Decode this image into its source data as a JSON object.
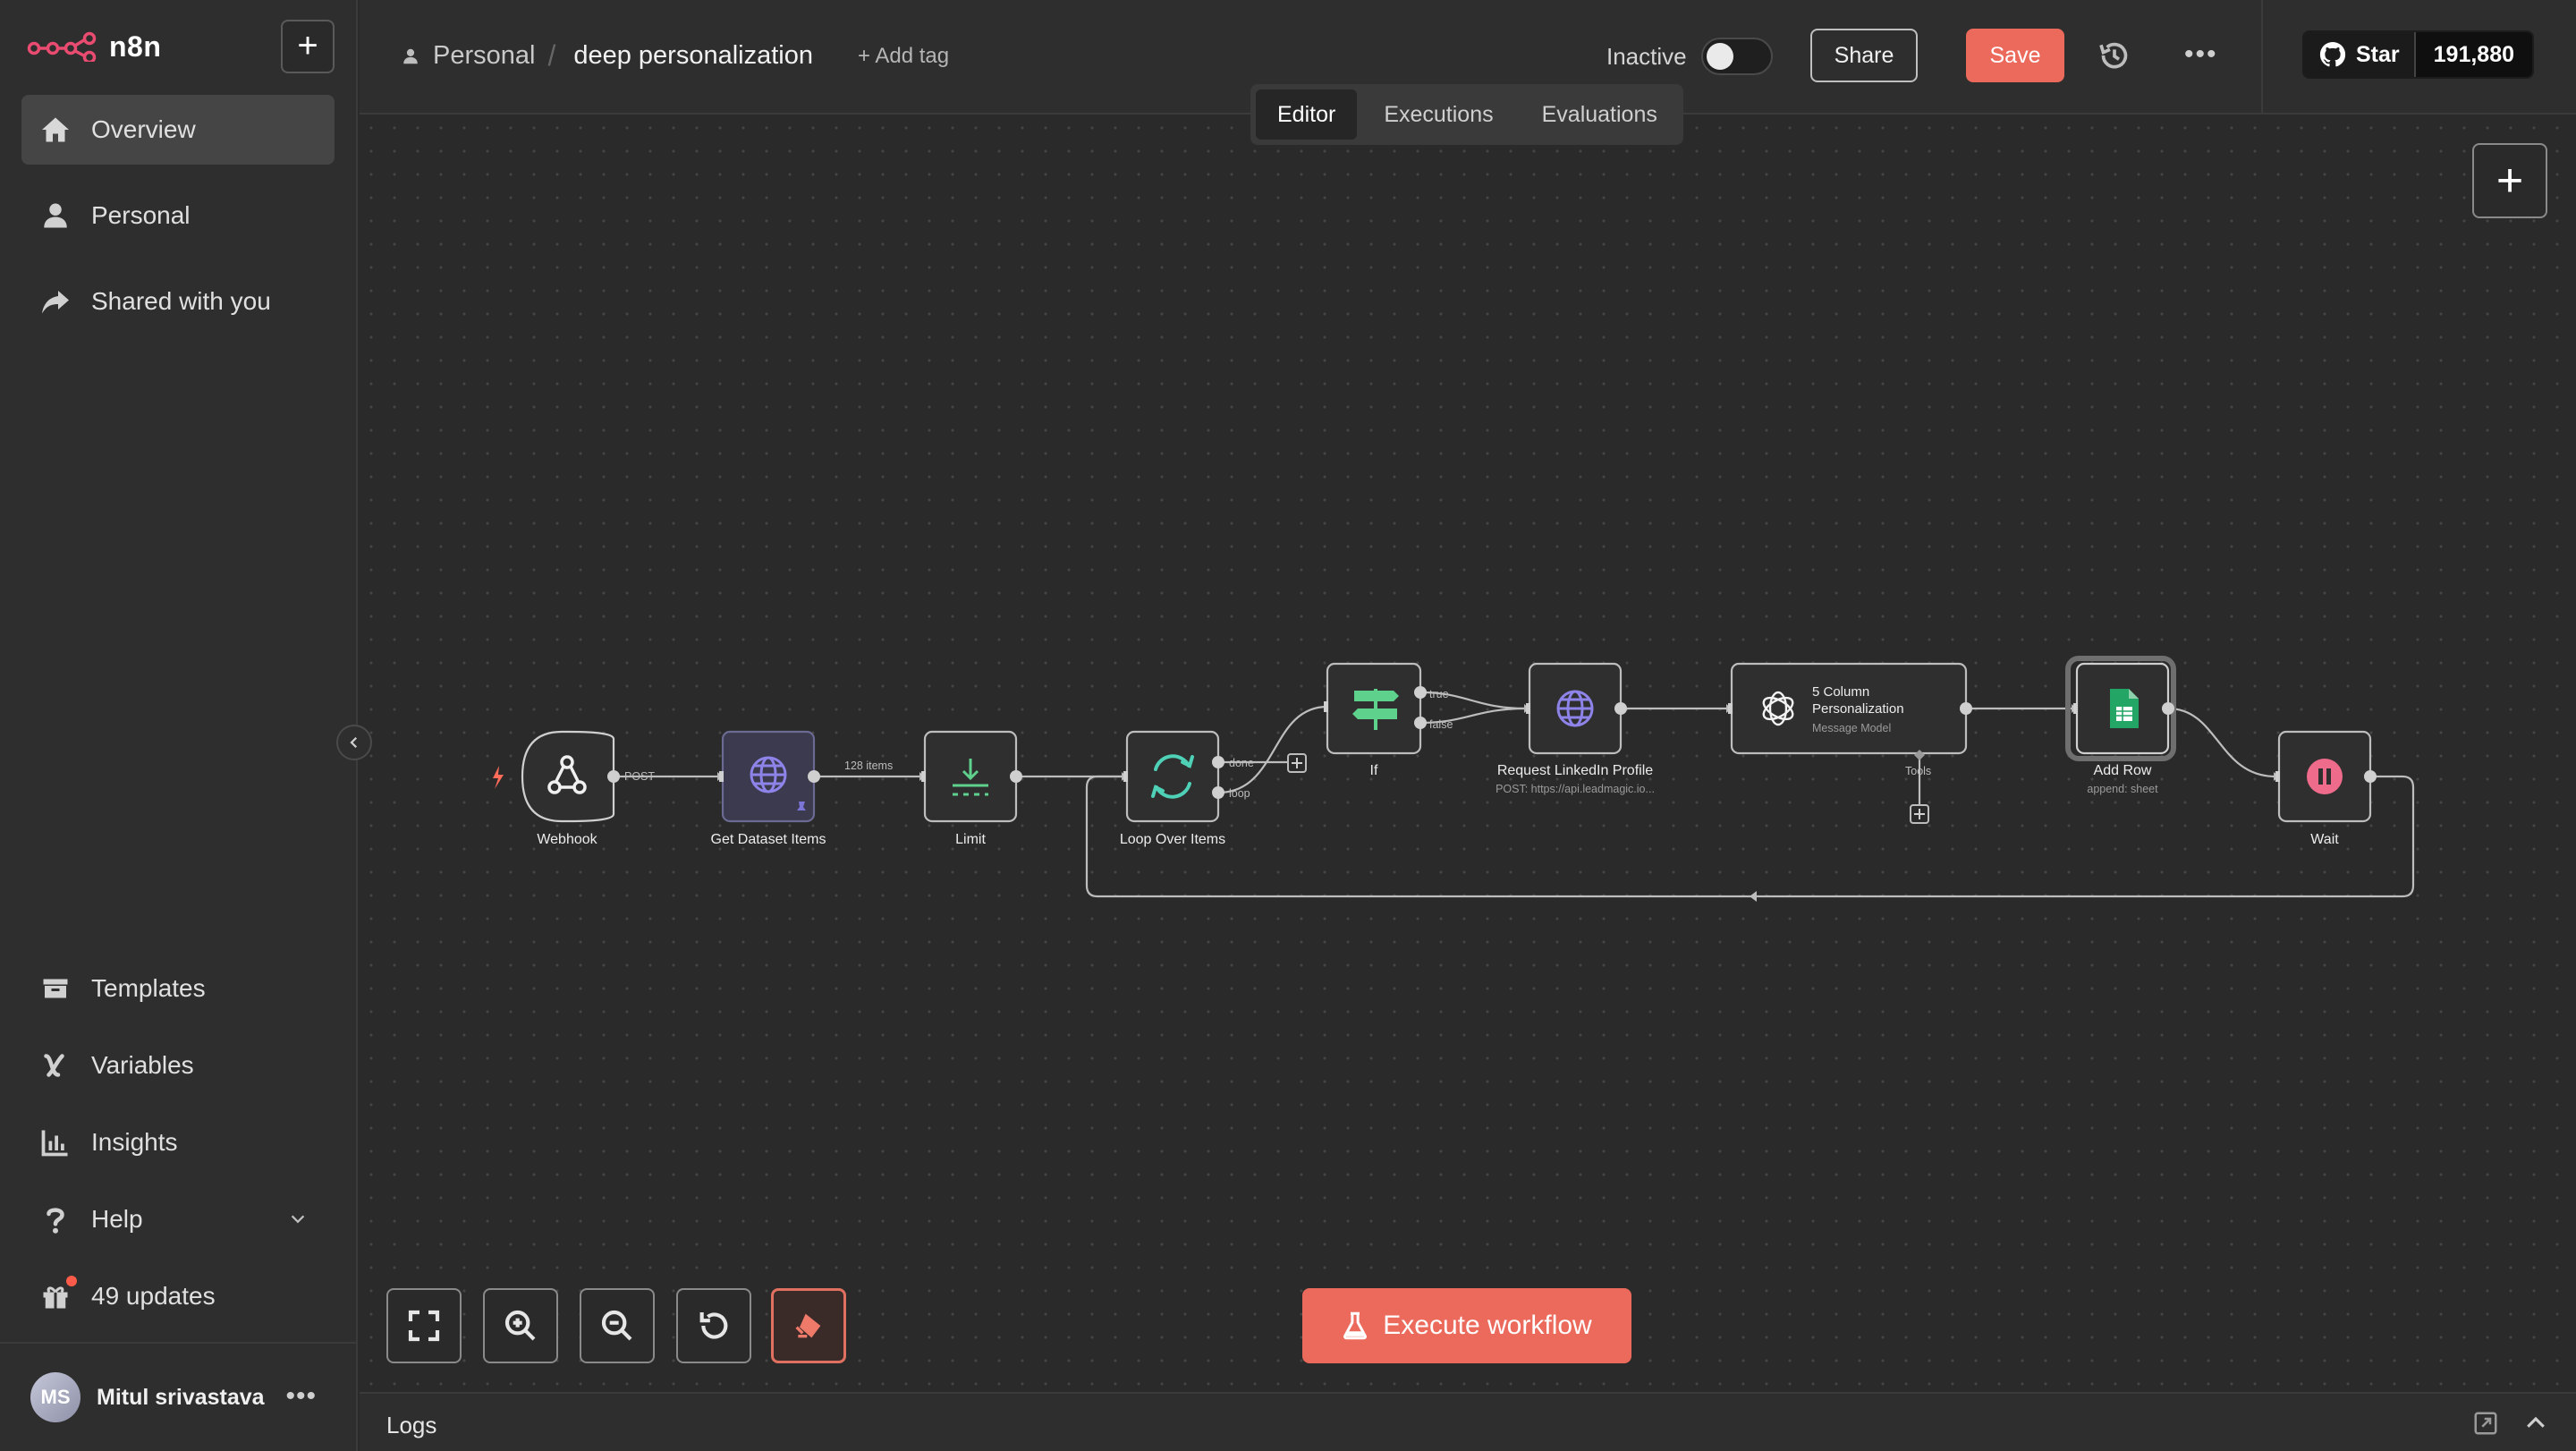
{
  "app": {
    "brand": "n8n"
  },
  "sidebar": {
    "items": [
      {
        "label": "Overview",
        "icon": "home-icon"
      },
      {
        "label": "Personal",
        "icon": "user-icon"
      },
      {
        "label": "Shared with you",
        "icon": "share-icon"
      }
    ],
    "bottom_items": [
      {
        "label": "Templates",
        "icon": "templates-icon"
      },
      {
        "label": "Variables",
        "icon": "variables-icon"
      },
      {
        "label": "Insights",
        "icon": "insights-icon"
      },
      {
        "label": "Help",
        "icon": "help-icon"
      },
      {
        "label": "49 updates",
        "icon": "gift-icon"
      }
    ],
    "user": {
      "initials": "MS",
      "name": "Mitul srivastava"
    }
  },
  "header": {
    "breadcrumb_project": "Personal",
    "breadcrumb_separator": "/",
    "workflow_name": "deep personalization",
    "add_tag": "+ Add tag",
    "status_label": "Inactive",
    "share_label": "Share",
    "save_label": "Save",
    "github_star_label": "Star",
    "github_star_count": "191,880"
  },
  "tabs": [
    {
      "label": "Editor",
      "active": true
    },
    {
      "label": "Executions",
      "active": false
    },
    {
      "label": "Evaluations",
      "active": false
    }
  ],
  "workflow": {
    "nodes": {
      "webhook": {
        "label": "Webhook"
      },
      "dataset": {
        "label": "Get Dataset Items"
      },
      "limit": {
        "label": "Limit"
      },
      "loop": {
        "label": "Loop Over Items"
      },
      "if": {
        "label": "If"
      },
      "linkedin": {
        "label": "Request LinkedIn Profile",
        "subtitle": "POST: https://api.leadmagic.io..."
      },
      "ai_line1": "5 Column",
      "ai_line2": "Personalization",
      "ai_sub": "Message Model",
      "addrow": {
        "label": "Add Row",
        "subtitle": "append: sheet"
      },
      "wait": {
        "label": "Wait"
      }
    },
    "edges": {
      "post": "POST",
      "items_count": "128 items",
      "done": "done",
      "loop": "loop",
      "true": "true",
      "false": "false",
      "tools": "Tools"
    }
  },
  "controls": {
    "execute_label": "Execute workflow"
  },
  "logs": {
    "label": "Logs"
  },
  "colors": {
    "accent": "#eb6a5c",
    "canvas": "#2a2a2a",
    "sidebar": "#2e2e2e"
  }
}
